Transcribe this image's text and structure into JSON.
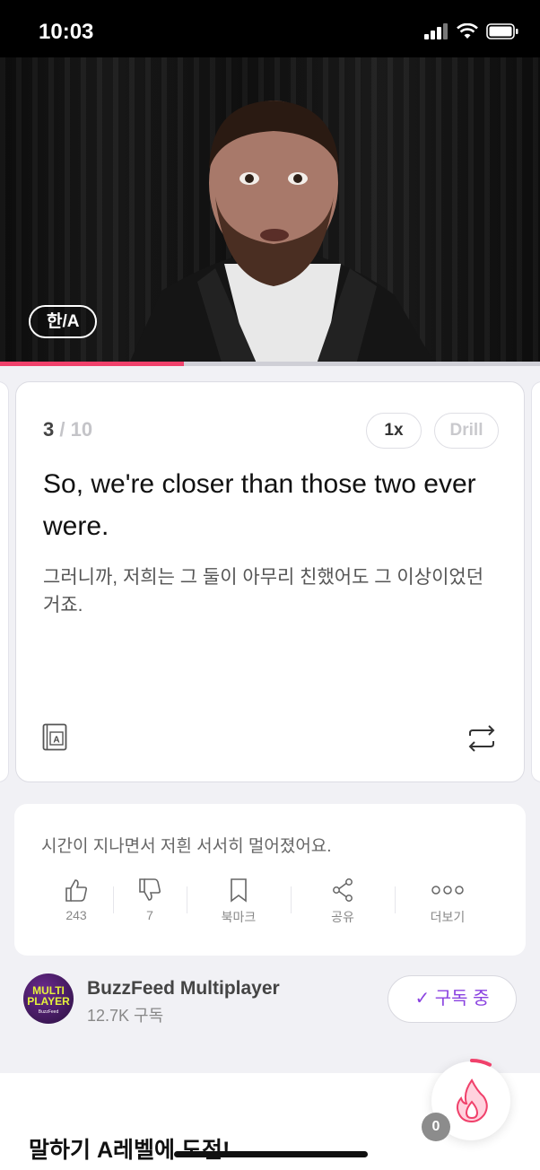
{
  "status_bar": {
    "time": "10:03"
  },
  "video": {
    "lang_toggle": "한/A",
    "progress": 0.34
  },
  "card": {
    "index": "3",
    "total": " / 10",
    "speed": "1x",
    "drill": "Drill",
    "sentence_en": "So, we're closer than those two ever were.",
    "sentence_ko": "그러니까, 저희는 그 둘이 아무리 친했어도 그 이상이었던 거죠."
  },
  "meta": {
    "next_text": "시간이 지나면서 저흰 서서히 멀어졌어요.",
    "actions": [
      {
        "label": "243"
      },
      {
        "label": "7"
      },
      {
        "label": "북마크"
      },
      {
        "label": "공유"
      },
      {
        "label": "더보기"
      }
    ]
  },
  "channel": {
    "logo_text": "MULTI PLAYER",
    "logo_sub": "BuzzFeed",
    "name": "BuzzFeed Multiplayer",
    "subscribers": "12.7K 구독",
    "subscribe_label": "✓ 구독 중"
  },
  "bottom": {
    "challenge_title": "말하기 A레벨에 도전!"
  },
  "streak": {
    "count": "0"
  },
  "colors": {
    "accent": "#f0416b",
    "subscribe": "#8a42e0"
  }
}
